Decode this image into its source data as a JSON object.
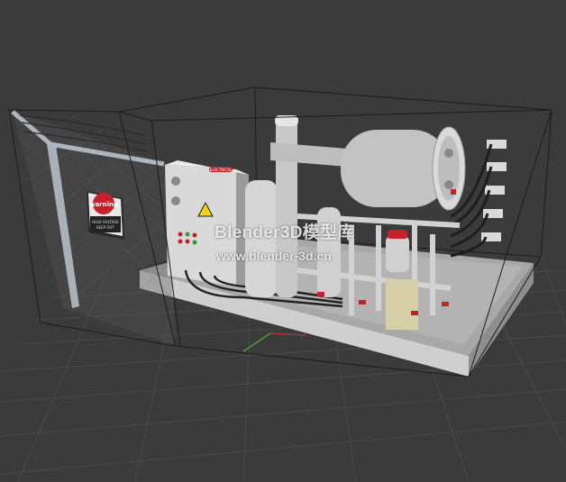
{
  "watermark": {
    "title": "Blender3D模型库",
    "url": "www.blender-3d.cn"
  },
  "sign": {
    "heading": "warning",
    "body_line1": "HIGH VOLTAGE",
    "body_line2": "KEEP OUT"
  },
  "panel": {
    "label": "ELECTRICAL"
  },
  "colors": {
    "background": "#3b3b3b",
    "grid_line": "#4a4a4a",
    "wireframe": "#1c1c1c",
    "concrete": "#c9c9c9",
    "metal": "#cfcfcf",
    "accent_red": "#c8202a",
    "hazard_yellow": "#f2d21a"
  }
}
